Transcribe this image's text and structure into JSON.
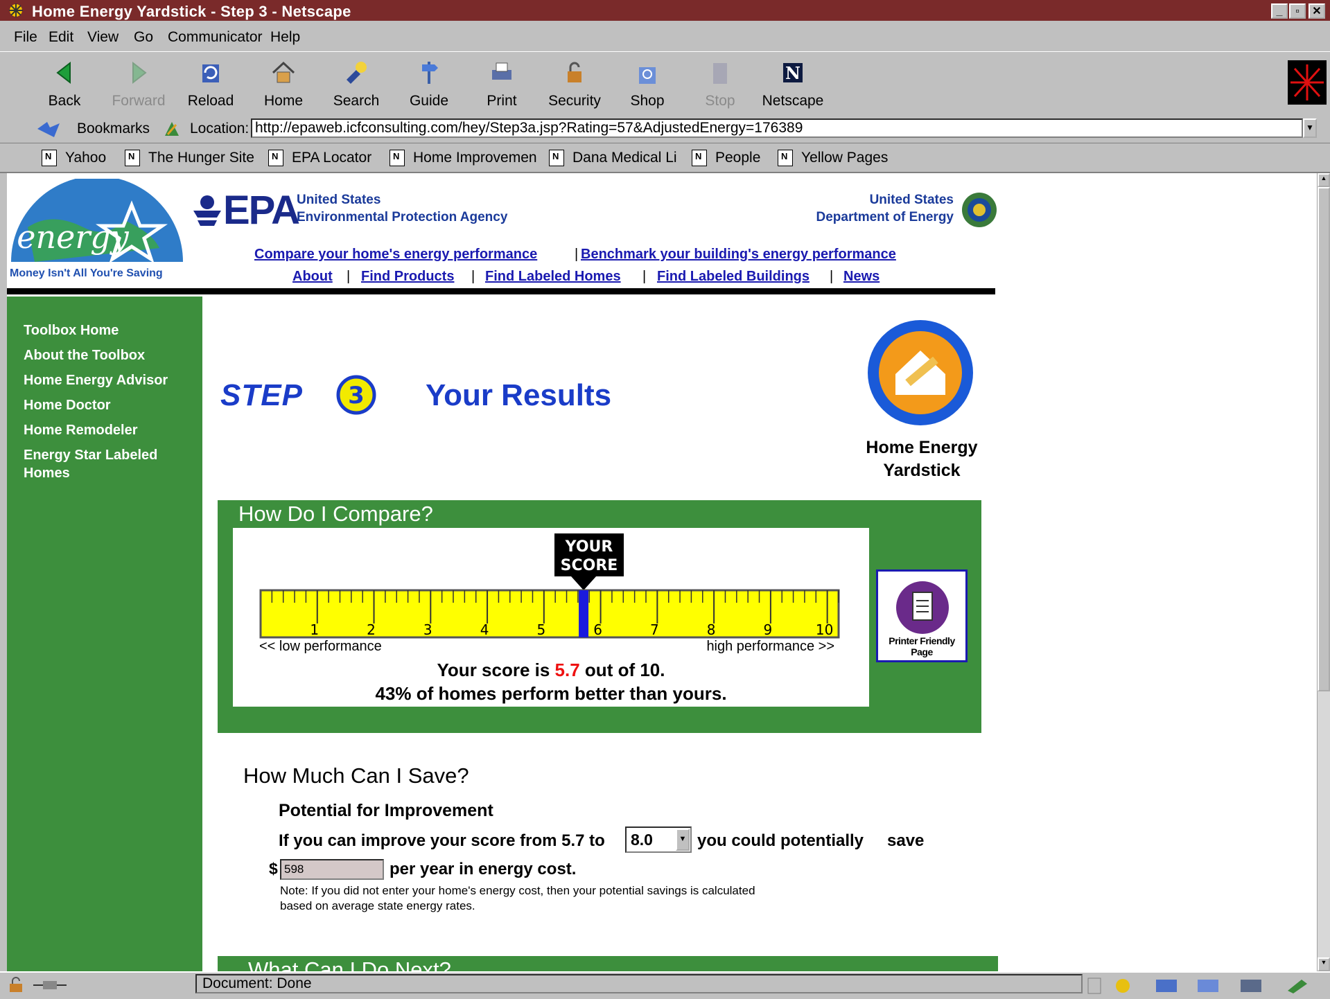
{
  "window": {
    "title": "Home Energy Yardstick - Step 3 - Netscape"
  },
  "menu": [
    "File",
    "Edit",
    "View",
    "Go",
    "Communicator",
    "Help"
  ],
  "toolbar": [
    "Back",
    "Forward",
    "Reload",
    "Home",
    "Search",
    "Guide",
    "Print",
    "Security",
    "Shop",
    "Stop",
    "Netscape"
  ],
  "location": {
    "bookmarks_label": "Bookmarks",
    "label": "Location:",
    "url": "http://epaweb.icfconsulting.com/hey/Step3a.jsp?Rating=57&AdjustedEnergy=176389"
  },
  "personal_toolbar": [
    "Yahoo",
    "The Hunger Site",
    "EPA Locator",
    "Home Improvemen",
    "Dana Medical Li",
    "People",
    "Yellow Pages"
  ],
  "header": {
    "energy_logo_text": "energy",
    "tagline": "Money Isn't All You're Saving",
    "epa": "EPA",
    "epa_line1": "United States",
    "epa_line2": "Environmental Protection Agency",
    "doe_line1": "United States",
    "doe_line2": "Department of Energy",
    "link_compare": "Compare your home's energy performance",
    "link_benchmark": "Benchmark your building's energy performance",
    "nav": [
      "About",
      "Find Products",
      "Find Labeled Homes",
      "Find Labeled Buildings",
      "News"
    ]
  },
  "sidebar": [
    "Toolbox Home",
    "About the Toolbox",
    "Home Energy Advisor",
    "Home Doctor",
    "Home Remodeler",
    "Energy Star Labeled",
    "Homes"
  ],
  "step": {
    "word": "STEP",
    "number": "3",
    "title": "Your Results"
  },
  "yardstick": {
    "line1": "Home Energy",
    "line2": "Yardstick"
  },
  "compare": {
    "heading": "How Do I Compare?",
    "your_score_1": "YOUR",
    "your_score_2": "SCORE",
    "ticks": [
      "1",
      "2",
      "3",
      "4",
      "5",
      "6",
      "7",
      "8",
      "9",
      "10"
    ],
    "score": 5.7,
    "low": "<< low performance",
    "high": "high performance >>",
    "result_pre": "Your score is ",
    "result_value": "5.7",
    "result_post": " out of 10.",
    "percent_line": "43% of homes perform better than yours.",
    "printer_1": "Printer Friendly",
    "printer_2": "Page"
  },
  "save": {
    "heading": "How Much Can I Save?",
    "subheading": "Potential for Improvement",
    "line_pre": "If you can improve your score from 5.7 to",
    "select_value": "8.0",
    "line_post": "you could potentially",
    "save_word": "save",
    "dollar": "$",
    "amount": "598",
    "per_year": "per year in energy cost.",
    "note1": "Note: If you did not enter your home's energy cost, then your potential savings is calculated",
    "note2": "based on average state energy rates."
  },
  "next": {
    "heading": "What Can I Do Next?"
  },
  "status": {
    "text": "Document: Done"
  },
  "colors": {
    "green": "#3d8f3d",
    "link": "#1a1ab0",
    "title": "#1a3cc8",
    "ruler": "#ffff00",
    "score_red": "#ee1111"
  }
}
